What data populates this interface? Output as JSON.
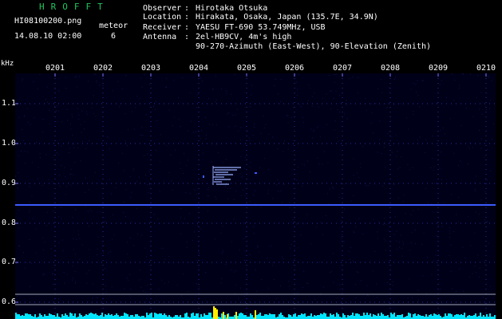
{
  "app": {
    "brand": "HROFFT",
    "filename": "HI08100200.png",
    "datetime": "14.08.10 02:00",
    "meteor_label": "meteor",
    "meteor_count": "6"
  },
  "info": {
    "observer_label": "Observer",
    "observer": "Hirotaka Otsuka",
    "location_label": "Location",
    "location": "Hirakata, Osaka, Japan (135.7E, 34.9N)",
    "receiver_label": "Receiver",
    "receiver": "YAESU FT-690 53.749MHz, USB",
    "antenna_label": "Antenna",
    "antenna_line1": "2el-HB9CV, 4m's high",
    "antenna_line2": "90-270-Azimuth (East-West), 90-Elevation (Zenith)"
  },
  "spectrogram": {
    "y_unit": "kHz",
    "x_ticks": [
      "0201",
      "0202",
      "0203",
      "0204",
      "0205",
      "0206",
      "0207",
      "0208",
      "0209",
      "0210"
    ],
    "y_ticks": [
      "1.1",
      "1.0",
      "0.9",
      "0.8",
      "0.7",
      "0.6"
    ],
    "colors": {
      "background": "#000018",
      "grid": "#2a2aa0",
      "carrier": "#3b5bff",
      "echo": "#9bb0ff",
      "noise": "#00e5ff",
      "burst": "#ffee00",
      "baseline": "#cfd6e8"
    }
  }
}
